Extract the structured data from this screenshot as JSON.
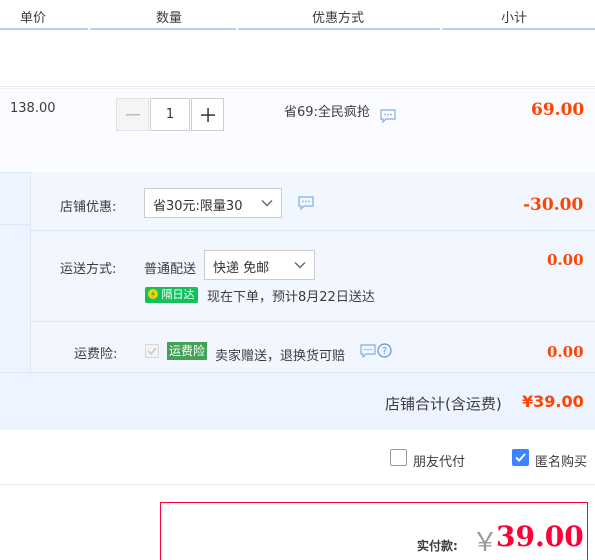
{
  "header": {
    "unit_price": "单价",
    "quantity": "数量",
    "discount_method": "优惠方式",
    "subtotal": "小计"
  },
  "item": {
    "price": "138.00",
    "quantity_minus": "—",
    "quantity_value": "1",
    "quantity_plus": "+",
    "promo": "省69:全民疯抢",
    "subtotal": "69.00"
  },
  "shop_discount": {
    "label": "店铺优惠:",
    "selected": "省30元:限量30",
    "amount": "-30.00"
  },
  "shipping": {
    "label": "运送方式:",
    "method_prefix": "普通配送",
    "selected": "快递 免邮",
    "badge": "隔日达",
    "note": "现在下单，预计8月22日送达",
    "amount": "0.00"
  },
  "freight_insurance": {
    "label": "运费险:",
    "badge": "运费险",
    "note": "卖家赠送，退换货可赔",
    "amount": "0.00"
  },
  "shop_total": {
    "label": "店铺合计(含运费)",
    "value": "¥39.00"
  },
  "options": {
    "friend_pay_label": "朋友代付",
    "friend_pay_checked": false,
    "anonymous_label": "匿名购买",
    "anonymous_checked": true
  },
  "payment": {
    "label": "实付款:",
    "currency": "￥",
    "value": "39.00"
  },
  "colors": {
    "price_red": "#ff4400",
    "pay_red": "#ff0036",
    "header_line": "#b2d1ff",
    "shop_bg": "#eef4ff",
    "checkbox_blue": "#3d84ff",
    "badge_green": "#13c05c"
  },
  "icons": [
    "chat-icon",
    "chevron-down-icon",
    "lightning-icon",
    "help-icon",
    "check-icon"
  ]
}
